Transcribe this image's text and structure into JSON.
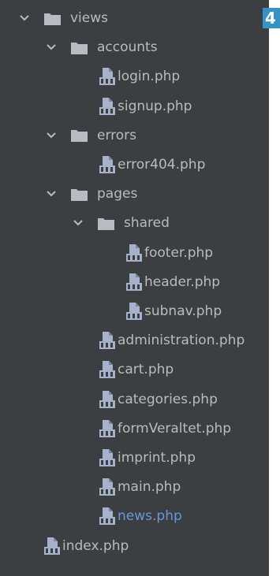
{
  "badge": "4",
  "tree": [
    {
      "name": "views",
      "type": "folder",
      "expanded": true,
      "depth": 0
    },
    {
      "name": "accounts",
      "type": "folder",
      "expanded": true,
      "depth": 1
    },
    {
      "name": "login.php",
      "type": "php",
      "depth": 2
    },
    {
      "name": "signup.php",
      "type": "php",
      "depth": 2
    },
    {
      "name": "errors",
      "type": "folder",
      "expanded": true,
      "depth": 1
    },
    {
      "name": "error404.php",
      "type": "php",
      "depth": 2
    },
    {
      "name": "pages",
      "type": "folder",
      "expanded": true,
      "depth": 1
    },
    {
      "name": "shared",
      "type": "folder",
      "expanded": true,
      "depth": 2
    },
    {
      "name": "footer.php",
      "type": "php",
      "depth": 3
    },
    {
      "name": "header.php",
      "type": "php",
      "depth": 3
    },
    {
      "name": "subnav.php",
      "type": "php",
      "depth": 3
    },
    {
      "name": "administration.php",
      "type": "php",
      "depth": 2
    },
    {
      "name": "cart.php",
      "type": "php",
      "depth": 2
    },
    {
      "name": "categories.php",
      "type": "php",
      "depth": 2
    },
    {
      "name": "formVeraltet.php",
      "type": "php",
      "depth": 2
    },
    {
      "name": "imprint.php",
      "type": "php",
      "depth": 2
    },
    {
      "name": "main.php",
      "type": "php",
      "depth": 2
    },
    {
      "name": "news.php",
      "type": "php",
      "depth": 2,
      "highlight": true
    },
    {
      "name": "index.php",
      "type": "php",
      "depth": 0
    }
  ],
  "colors": {
    "background": "#3c3f41",
    "text": "#bbbbbb",
    "highlight_text": "#6a97d4",
    "folder": "#b8bcc2",
    "php_icon": "#a7b1c9",
    "badge": "#3592c4"
  }
}
